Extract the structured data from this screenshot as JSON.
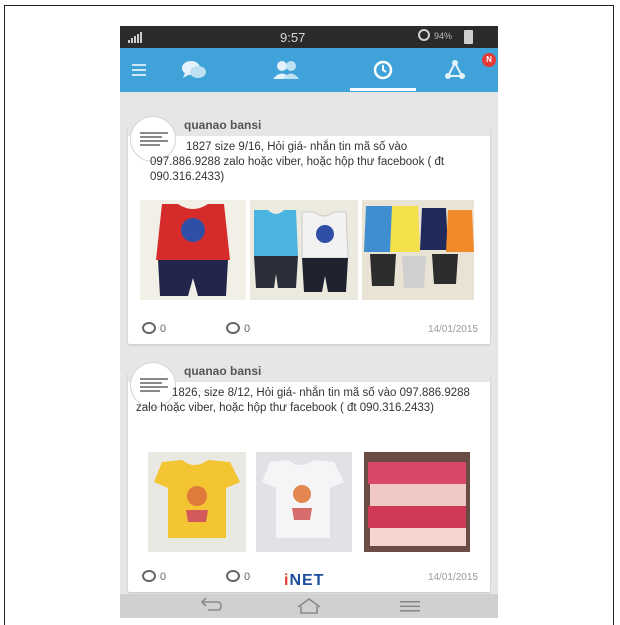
{
  "status_bar": {
    "time": "9:57",
    "battery_text": "94%"
  },
  "nav": {
    "tabs": [
      {
        "icon": "menu-icon"
      },
      {
        "icon": "chat-icon"
      },
      {
        "icon": "friends-icon"
      },
      {
        "icon": "timeline-icon",
        "active": true
      },
      {
        "icon": "share-icon",
        "badge": "N"
      }
    ]
  },
  "posts": [
    {
      "username": "quanao bansi",
      "text": "1827 size 9/16, Hỏi giá- nhắn tin mã số vào 097.886.9288 zalo hoặc viber, hoặc hộp thư facebook ( đt 090.316.2433)",
      "likes": "0",
      "comments": "0",
      "date": "14/01/2015"
    },
    {
      "username": "quanao bansi",
      "text": "1826, size 8/12, Hỏi giá- nhắn tin mã số vào 097.886.9288 zalo hoặc viber, hoặc hộp thư facebook ( đt 090.316.2433)",
      "likes": "0",
      "comments": "0",
      "date": "14/01/2015"
    }
  ],
  "watermark": {
    "i": "i",
    "rest": "NET"
  },
  "colors": {
    "nav": "#3fa2d8",
    "badge": "#e53935"
  }
}
